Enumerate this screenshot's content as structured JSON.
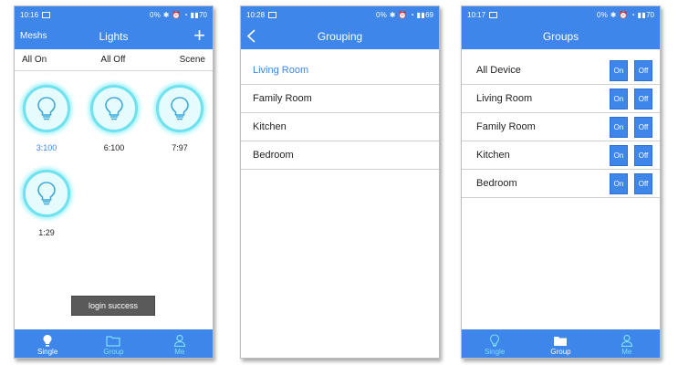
{
  "phone1": {
    "status": {
      "time": "10:16",
      "right": "0% ✱ ⏰ ◔ ▮▮ ",
      "battery": "70"
    },
    "header": {
      "left": "Meshs",
      "title": "Lights",
      "add": "+"
    },
    "top_tabs": [
      "All On",
      "All Off",
      "Scene"
    ],
    "bulbs": [
      {
        "label": "3:100",
        "active": true
      },
      {
        "label": "6:100",
        "active": false
      },
      {
        "label": "7:97",
        "active": false
      },
      {
        "label": "1:29",
        "active": false
      }
    ],
    "toast": "login success",
    "tabbar": [
      {
        "label": "Single",
        "icon": "bulb-icon",
        "active": true
      },
      {
        "label": "Group",
        "icon": "folder-icon",
        "active": false
      },
      {
        "label": "Me",
        "icon": "person-icon",
        "active": false
      }
    ]
  },
  "phone2": {
    "status": {
      "time": "10:28",
      "right": "0% ✱ ⏰ ◔ ▮▮ ",
      "battery": "69"
    },
    "header": {
      "title": "Grouping"
    },
    "items": [
      "Living Room",
      "Family Room",
      "Kitchen",
      "Bedroom"
    ],
    "selected_index": 0
  },
  "phone3": {
    "status": {
      "time": "10:17",
      "right": "0% ✱ ⏰ ◔ ▮▮ ",
      "battery": "70"
    },
    "header": {
      "title": "Groups"
    },
    "groups": [
      "All Device",
      "Living Room",
      "Family Room",
      "Kitchen",
      "Bedroom"
    ],
    "on_label": "On",
    "off_label": "Off",
    "tabbar": [
      {
        "label": "Single",
        "icon": "bulb-icon",
        "active": false
      },
      {
        "label": "Group",
        "icon": "folder-icon",
        "active": true
      },
      {
        "label": "Me",
        "icon": "person-icon",
        "active": false
      }
    ]
  },
  "colors": {
    "primary": "#3e86ea",
    "bulb_ring": "#6fe2ef",
    "tab_inactive": "#7fe0f0"
  }
}
